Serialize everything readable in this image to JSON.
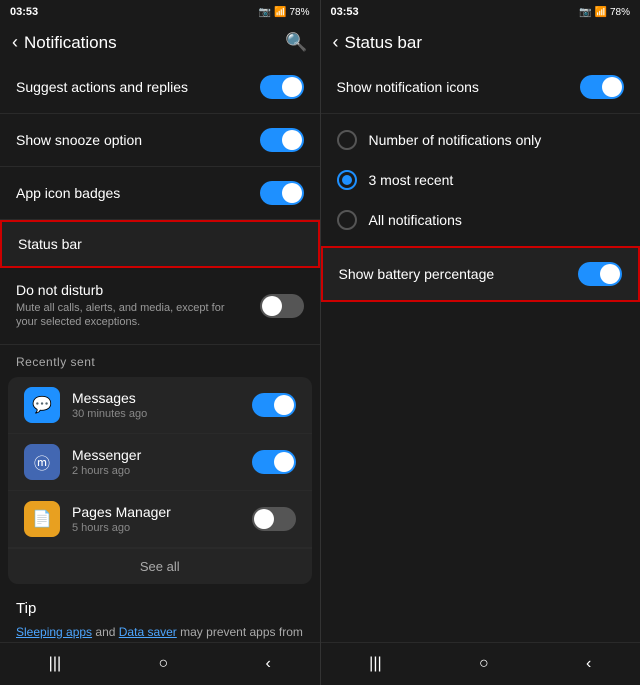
{
  "left": {
    "statusBar": {
      "time": "03:53",
      "batteryIcon": "🔋",
      "signal": "📶",
      "batteryPercent": "78%"
    },
    "header": {
      "title": "Notifications",
      "backLabel": "‹",
      "searchIcon": "🔍"
    },
    "items": [
      {
        "id": "suggest",
        "label": "Suggest actions and replies",
        "toggle": "on"
      },
      {
        "id": "snooze",
        "label": "Show snooze option",
        "toggle": "on"
      },
      {
        "id": "badges",
        "label": "App icon badges",
        "toggle": "on"
      },
      {
        "id": "statusbar",
        "label": "Status bar",
        "toggle": null,
        "highlighted": true
      }
    ],
    "doNotDisturb": {
      "label": "Do not disturb",
      "sub": "Mute all calls, alerts, and media, except for your selected exceptions.",
      "toggle": "off"
    },
    "recentlySent": {
      "label": "Recently sent",
      "apps": [
        {
          "id": "messages",
          "name": "Messages",
          "time": "30 minutes ago",
          "toggle": "on",
          "iconType": "messages",
          "icon": "💬"
        },
        {
          "id": "messenger",
          "name": "Messenger",
          "time": "2 hours ago",
          "toggle": "on",
          "iconType": "messenger",
          "icon": "💬"
        },
        {
          "id": "pages",
          "name": "Pages Manager",
          "time": "5 hours ago",
          "toggle": "off",
          "iconType": "pages",
          "icon": "📄"
        }
      ],
      "seeAll": "See all"
    },
    "tip": {
      "title": "Tip",
      "text1": "Sleeping apps",
      "text2": " and ",
      "text3": "Data saver",
      "text4": " may prevent apps from sending you notifications. Tap"
    },
    "navBar": {
      "btn1": "|||",
      "btn2": "○",
      "btn3": "‹"
    }
  },
  "right": {
    "statusBar": {
      "time": "03:53",
      "batteryPercent": "78%"
    },
    "header": {
      "title": "Status bar",
      "backLabel": "‹"
    },
    "showNotificationIcons": {
      "label": "Show notification icons",
      "toggle": "on"
    },
    "radioOptions": [
      {
        "id": "number-only",
        "label": "Number of notifications only",
        "selected": false
      },
      {
        "id": "three-recent",
        "label": "3 most recent",
        "selected": true
      },
      {
        "id": "all",
        "label": "All notifications",
        "selected": false
      }
    ],
    "showBattery": {
      "label": "Show battery percentage",
      "toggle": "on",
      "highlighted": true
    },
    "navBar": {
      "btn1": "|||",
      "btn2": "○",
      "btn3": "‹"
    }
  }
}
